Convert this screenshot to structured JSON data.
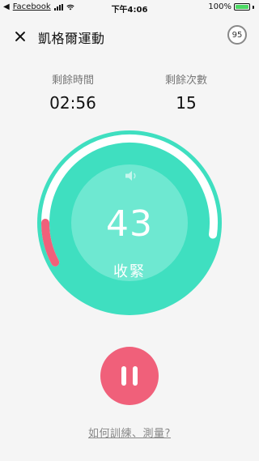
{
  "status_bar": {
    "back_glyph": "◀",
    "app": "Facebook",
    "time": "下午4:06",
    "battery": "100%",
    "battery_level": 1.0
  },
  "header": {
    "title": "凱格爾運動",
    "score": "95"
  },
  "stats": {
    "time_label": "剩餘時間",
    "time_value": "02:56",
    "reps_label": "剩餘次數",
    "reps_value": "15"
  },
  "dial": {
    "count": "43",
    "phase": "收緊",
    "remaining_fraction": 0.78,
    "colors": {
      "ring": "#3fdfc0",
      "inner": "#6ee8d1",
      "track": "#ffffff",
      "progress": "#f0607a"
    }
  },
  "controls": {
    "pause_icon": "pause-icon",
    "pause_color": "#f0607a"
  },
  "help": {
    "link": "如何訓練、測量?"
  }
}
